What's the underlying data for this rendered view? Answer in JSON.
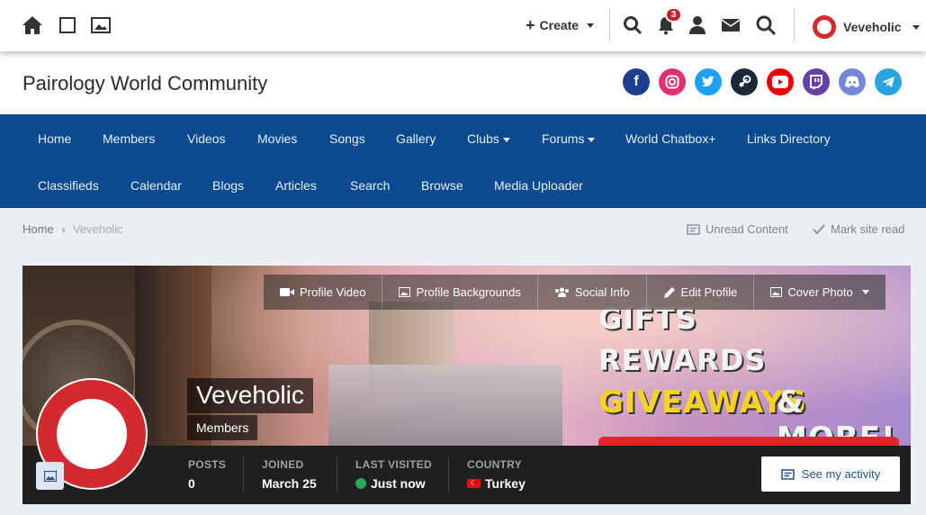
{
  "userbar": {
    "create_label": "Create",
    "notification_count": "3",
    "username": "Veveholic"
  },
  "header": {
    "site_title": "Pairology World Community",
    "social": [
      "facebook",
      "instagram",
      "twitter",
      "steam",
      "youtube",
      "twitch",
      "discord",
      "telegram"
    ]
  },
  "nav": {
    "row1": [
      {
        "label": "Home"
      },
      {
        "label": "Members"
      },
      {
        "label": "Videos"
      },
      {
        "label": "Movies"
      },
      {
        "label": "Songs"
      },
      {
        "label": "Gallery"
      },
      {
        "label": "Clubs"
      },
      {
        "label": "Forums"
      },
      {
        "label": "World Chatbox+"
      },
      {
        "label": "Links Directory"
      }
    ],
    "row2": [
      {
        "label": "Classifieds"
      },
      {
        "label": "Calendar"
      },
      {
        "label": "Blogs"
      },
      {
        "label": "Articles"
      },
      {
        "label": "Search"
      },
      {
        "label": "Browse"
      },
      {
        "label": "Media Uploader"
      }
    ]
  },
  "breadcrumb": {
    "home": "Home",
    "current": "Veveholic",
    "unread": "Unread Content",
    "mark_read": "Mark site read"
  },
  "profile": {
    "tools": {
      "video": "Profile Video",
      "backgrounds": "Profile Backgrounds",
      "social": "Social Info",
      "edit": "Edit Profile",
      "cover": "Cover Photo"
    },
    "promo": {
      "line1": "GIFTS",
      "line2": "REWARDS",
      "line3a": "GIVEAWAYS",
      "line3b": "& MORE!"
    },
    "name": "Veveholic",
    "group": "Members",
    "stats": {
      "posts_label": "POSTS",
      "posts": "0",
      "joined_label": "JOINED",
      "joined": "March 25",
      "visited_label": "LAST VISITED",
      "visited": "Just now",
      "country_label": "COUNTRY",
      "country": "Turkey"
    },
    "activity_button": "See my activity"
  },
  "colors": {
    "nav_bg": "#0b4a8f",
    "avatar_ring": "#d42a2f",
    "stat_bar": "#1f1f1f",
    "online": "#2aa85a"
  }
}
